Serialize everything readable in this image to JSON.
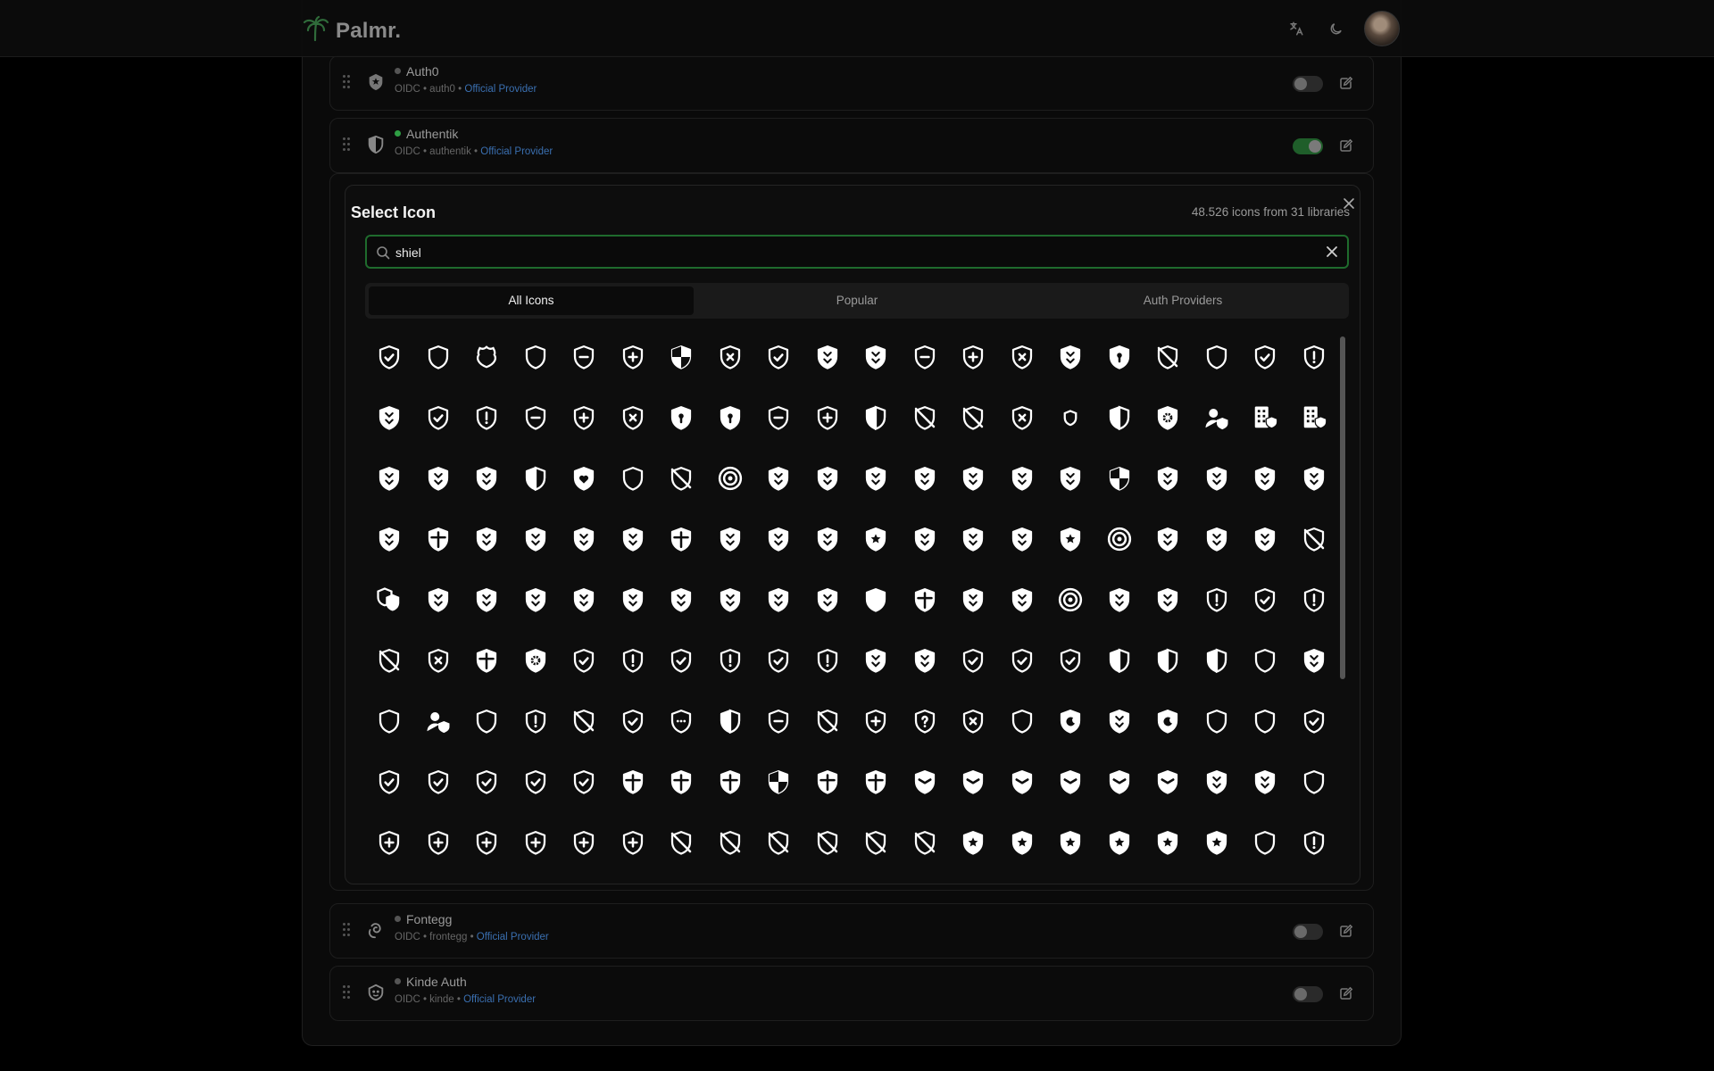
{
  "app": {
    "brand": "Palmr.",
    "accent": "#1f6b2d",
    "icons": [
      "palm-logo-icon",
      "translate-icon",
      "moon-icon",
      "avatar"
    ]
  },
  "providers_top": [
    {
      "name": "Auth0",
      "type": "OIDC",
      "slug": "auth0",
      "badge": "Official Provider",
      "enabled": false,
      "icon": "auth0-icon"
    },
    {
      "name": "Authentik",
      "type": "OIDC",
      "slug": "authentik",
      "badge": "Official Provider",
      "enabled": true,
      "icon": "shield-half-icon"
    }
  ],
  "providers_bottom": [
    {
      "name": "Fontegg",
      "type": "OIDC",
      "slug": "frontegg",
      "badge": "Official Provider",
      "enabled": false,
      "icon": "frontegg-icon"
    },
    {
      "name": "Kinde Auth",
      "type": "OIDC",
      "slug": "kinde",
      "badge": "Official Provider",
      "enabled": false,
      "icon": "kinde-icon"
    }
  ],
  "meta_separator": " • ",
  "dialog": {
    "title": "Select Icon",
    "count": "48.526 icons from 31 libraries",
    "search_value": "shiel",
    "tabs": [
      {
        "label": "All Icons",
        "active": true
      },
      {
        "label": "Popular",
        "active": false
      },
      {
        "label": "Auth Providers",
        "active": false
      }
    ],
    "icon_rows": [
      [
        "shield-check-icon",
        "shield-outline-icon",
        "police-badge-icon",
        "shield-outline-icon",
        "shield-minus-icon",
        "shield-plus-icon",
        "shield-checkered-icon",
        "shield-x-icon",
        "shield-check-icon",
        "shield-filled-icon",
        "shield-filled-icon",
        "shield-minus-icon",
        "shield-plus-icon",
        "shield-x-icon",
        "shield-filled-icon",
        "shield-lock-icon",
        "shield-off-icon",
        "shield-outline-icon",
        "shield-check-icon",
        "shield-alert-icon"
      ],
      [
        "shield-filled-icon",
        "shield-check-icon",
        "shield-alert-icon",
        "shield-minus-icon",
        "shield-plus-icon",
        "shield-x-icon",
        "shield-lock-icon",
        "shield-lock-icon",
        "shield-minus-icon",
        "shield-plus-icon",
        "shield-half-icon",
        "shield-off-icon",
        "shield-off-icon",
        "shield-x-icon",
        "shield-small-icon",
        "shield-half-icon",
        "shield-gear-icon",
        "user-shield-icon",
        "building-shield-icon",
        "file-shield-icon"
      ],
      [
        "shield-filled-icon",
        "shield-cat-icon",
        "shield-bird-icon",
        "shield-half-icon",
        "shield-heart-icon",
        "shield-outline-icon",
        "shield-off-icon",
        "round-shield-icon",
        "shield-bash-icon",
        "shield-reflect-icon",
        "shield-hooded-icon",
        "shield-hand-icon",
        "shield-wings-icon",
        "shield-ornate-icon",
        "shield-sword-icon",
        "shield-checkered-icon",
        "shield-lightning-icon",
        "shield-tower-icon",
        "shield-emblem-icon",
        "shield-cube-icon"
      ],
      [
        "shield-crest-icon",
        "shield-cross-icon",
        "shield-clover-icon",
        "shield-eye-icon",
        "shield-flame-icon",
        "shield-wolf-icon",
        "shield-cross-filled-icon",
        "shield-gem-icon",
        "shield-flower-icon",
        "shield-lightning-icon",
        "shield-star-burst-icon",
        "knight-helm-icon",
        "totem-icon",
        "shield-rune-icon",
        "shield-star-icon",
        "round-shield-icon",
        "shield-simple-icon",
        "running-shield-icon",
        "shield-spikes-icon",
        "shield-slash-icon"
      ],
      [
        "double-shield-icon",
        "shield-impact-icon",
        "shield-pair-icon",
        "shield-axe-icon",
        "shield-scale-icon",
        "shield-skull-icon",
        "shield-claw-icon",
        "shield-beast-icon",
        "shield-hands-icon",
        "shield-sword-icon",
        "shield-clock-icon",
        "crossed-swords-shield-icon",
        "shield-helmet-icon",
        "shield-gem-icon",
        "round-shield-icon",
        "shield-horns-icon",
        "shield-feather-icon",
        "shield-alert-icon",
        "shield-check-icon",
        "shield-alert-icon"
      ],
      [
        "shield-off-icon",
        "shield-x-icon",
        "shield-cross-icon",
        "shield-gear-icon",
        "shield-check-icon",
        "shield-alert-icon",
        "shield-check-icon",
        "shield-alert-icon",
        "shield-check-icon",
        "shield-alert-icon",
        "shield-filled-icon",
        "shield-filled-icon",
        "shield-check-icon",
        "shield-check-icon",
        "shield-check-icon",
        "shield-half-icon",
        "shield-half-icon",
        "shield-half-icon",
        "shield-outline-icon",
        "shield-filled-icon"
      ],
      [
        "shield-outline-icon",
        "user-shield-icon",
        "shield-outline-icon",
        "shield-alert-icon",
        "shield-slash-icon",
        "shield-check-icon",
        "shield-ellipsis-icon",
        "shield-half-icon",
        "shield-minus-icon",
        "shield-off-icon",
        "shield-plus-icon",
        "shield-question-icon",
        "shield-x-icon",
        "shield-outline-icon",
        "shield-moon-icon",
        "shield-filled-icon",
        "shield-moon-icon",
        "shield-outline-icon",
        "shield-outline-icon",
        "shield-check-icon"
      ],
      [
        "shield-check-icon",
        "shield-check-icon",
        "shield-check-icon",
        "shield-check-icon",
        "shield-check-icon",
        "shield-cross-icon",
        "shield-cross-icon",
        "shield-cross-icon",
        "shield-checkered-icon",
        "shield-cross-icon",
        "shield-cross-icon",
        "shield-chevron-icon",
        "shield-chevron-icon",
        "shield-chevron-icon",
        "shield-chevron-icon",
        "shield-chevron-icon",
        "shield-chevron-icon",
        "shield-filled-icon",
        "shield-filled-icon",
        "shield-outline-icon"
      ],
      [
        "shield-plus-icon",
        "shield-plus-icon",
        "shield-plus-icon",
        "shield-plus-icon",
        "shield-plus-icon",
        "shield-plus-icon",
        "shield-slash-icon",
        "shield-slash-icon",
        "shield-slash-icon",
        "shield-slash-icon",
        "shield-slash-icon",
        "shield-slash-icon",
        "shield-star-icon",
        "shield-star-icon",
        "shield-star-icon",
        "shield-star-icon",
        "shield-star-icon",
        "shield-star-icon",
        "shield-outline-icon",
        "shield-alert-icon"
      ]
    ]
  }
}
